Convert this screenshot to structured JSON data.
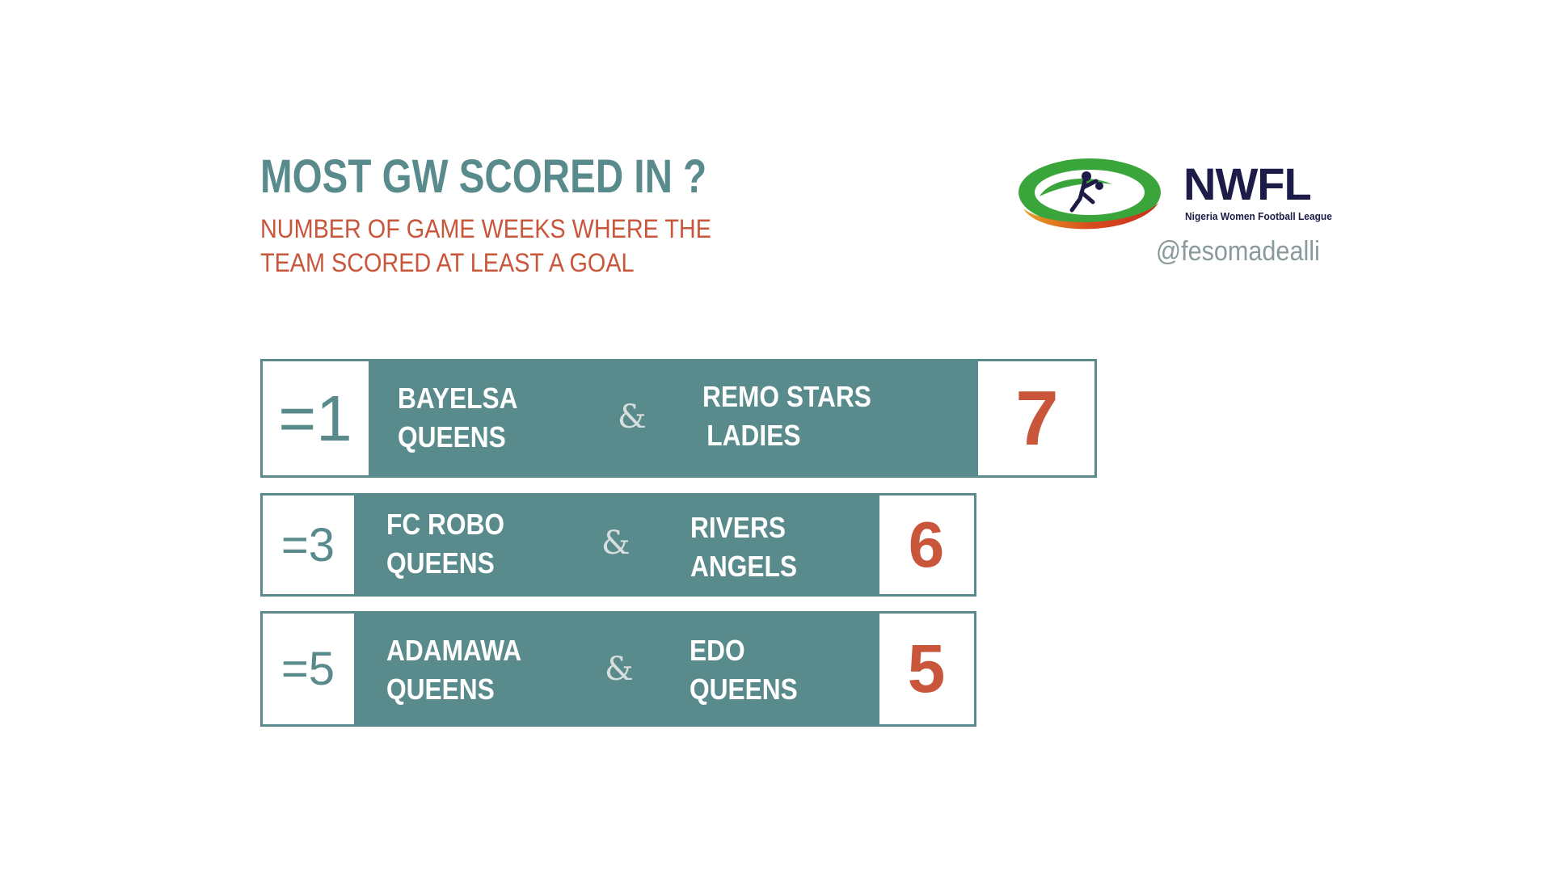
{
  "header": {
    "title": "MOST GW SCORED IN ?",
    "subtitle_line1": "NUMBER OF GAME WEEKS WHERE THE",
    "subtitle_line2": "TEAM SCORED AT LEAST A GOAL"
  },
  "brand": {
    "name": "NWFL",
    "tagline": "Nigeria Women Football League",
    "handle": "@fesomadealli"
  },
  "rows": [
    {
      "rank": "=1",
      "team1_line1": "BAYELSA",
      "team1_line2": "QUEENS",
      "separator": "&",
      "team2_line1": "REMO STARS",
      "team2_line2": "LADIES",
      "count": "7"
    },
    {
      "rank": "=3",
      "team1_line1": "FC ROBO",
      "team1_line2": "QUEENS",
      "separator": "&",
      "team2_line1": "RIVERS",
      "team2_line2": "ANGELS",
      "count": "6"
    },
    {
      "rank": "=5",
      "team1_line1": "ADAMAWA",
      "team1_line2": "QUEENS",
      "separator": "&",
      "team2_line1": "EDO",
      "team2_line2": "QUEENS",
      "count": "5"
    }
  ],
  "colors": {
    "teal": "#5a8b8c",
    "accent": "#c9553a",
    "navy": "#1d1b48"
  },
  "icons": {
    "logo": "nwfl-logo-icon"
  }
}
